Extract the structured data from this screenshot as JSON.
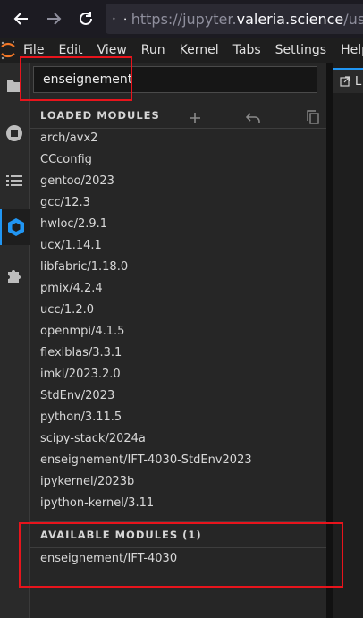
{
  "browser": {
    "url_prefix": "https://jupyter.",
    "url_host": "valeria.science",
    "url_suffix": "/use"
  },
  "menubar": {
    "items": [
      "File",
      "Edit",
      "View",
      "Run",
      "Kernel",
      "Tabs",
      "Settings",
      "Help"
    ]
  },
  "panel": {
    "filter_value": "enseignement",
    "loaded_title": "LOADED MODULES",
    "loaded_modules": [
      "arch/avx2",
      "CCconfig",
      "gentoo/2023",
      "gcc/12.3",
      "hwloc/2.9.1",
      "ucx/1.14.1",
      "libfabric/1.18.0",
      "pmix/4.2.4",
      "ucc/1.2.0",
      "openmpi/4.1.5",
      "flexiblas/3.3.1",
      "imkl/2023.2.0",
      "StdEnv/2023",
      "python/3.11.5",
      "scipy-stack/2024a",
      "enseignement/IFT-4030-StdEnv2023",
      "ipykernel/2023b",
      "ipython-kernel/3.11"
    ],
    "available_title": "AVAILABLE MODULES (1)",
    "available_modules": [
      "enseignement/IFT-4030"
    ]
  },
  "doc_tab": {
    "label": "L"
  },
  "colors": {
    "accent": "#2196f3",
    "highlight": "#e8141c"
  }
}
